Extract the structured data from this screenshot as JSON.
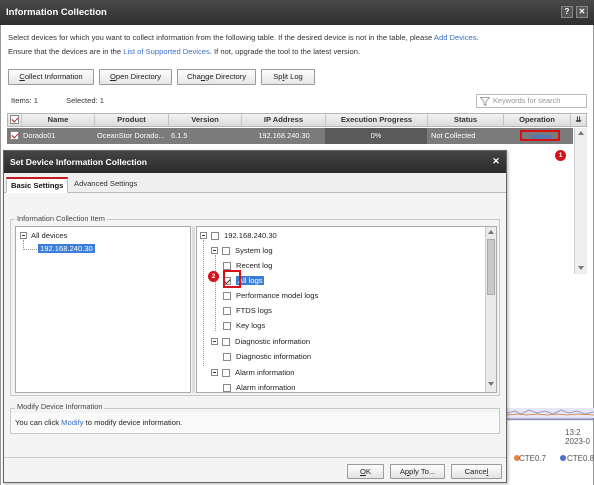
{
  "window": {
    "title": "Information Collection",
    "help_glyph": "?",
    "close_glyph": "✕"
  },
  "intro": {
    "line1_prefix": "Select devices for which you want to collect information from the following table. If the desired device is not in the table, please ",
    "line1_link": "Add Devices",
    "line1_suffix": ".",
    "line2_prefix": "Ensure that the devices are in the ",
    "line2_link": "List of Supported Devices",
    "line2_suffix": ". If not, upgrade the tool to the latest version."
  },
  "toolbar": {
    "collect_mn": "C",
    "collect_rest": "ollect Information",
    "open_mn": "O",
    "open_rest": "pen Directory",
    "change_pre": "Cha",
    "change_mn": "n",
    "change_rest": "ge Directory",
    "split_pre": "Sp",
    "split_mn": "l",
    "split_rest": "it Log"
  },
  "counts": {
    "items": "Items:  1",
    "selected": "Selected:  1"
  },
  "search": {
    "placeholder": "Keywords for search",
    "icon": "filter-icon"
  },
  "table": {
    "headers": [
      "Name",
      "Product",
      "Version",
      "IP Address",
      "Execution Progress",
      "Status",
      "Operation"
    ],
    "rows": [
      {
        "name": "Dorado01",
        "product": "OceanStor Dorado...",
        "version": "6.1.5",
        "ip": "192.168.240.30",
        "progress": "0%",
        "progress_value": 0,
        "status": "Not Collected",
        "operation": "Setting"
      }
    ]
  },
  "markers": {
    "m1": "1",
    "m2": "2"
  },
  "colors": {
    "accent_red": "#d4121a",
    "link_blue": "#3a6fc4",
    "selection_blue": "#3b7ed8"
  },
  "dialog": {
    "title": "Set Device Information Collection",
    "close_glyph": "✕",
    "tabs": [
      "Basic Settings",
      "Advanced Settings"
    ],
    "group_title": "Information Collection Item",
    "left_tree": {
      "root": "All devices",
      "child": "192.168.240.30"
    },
    "right_tree": {
      "root": "192.168.240.30",
      "system_log": "System log",
      "recent_log": "Recent log",
      "all_logs": "All logs",
      "perf_logs": "Performance model logs",
      "ftds_logs": "FTDS logs",
      "key_logs": "Key logs",
      "diag_info": "Diagnostic information",
      "diag_info_child": "Diagnostic information",
      "alarm_info": "Alarm information",
      "alarm_info_child": "Alarm information"
    },
    "modify": {
      "title": "Modify Device Information",
      "prefix": "You can click ",
      "link": "Modify",
      "suffix": " to modify device information."
    },
    "buttons": {
      "ok_mn": "O",
      "ok_rest": "K",
      "apply_pre": "A",
      "apply_mn": "p",
      "apply_rest": "ply To...",
      "cancel_pre": "Cance",
      "cancel_mn": "l"
    }
  },
  "background": {
    "time1": "13:2",
    "time2": "2023-0",
    "legend1": "CTE0.7",
    "legend2": "CTE0.8"
  }
}
